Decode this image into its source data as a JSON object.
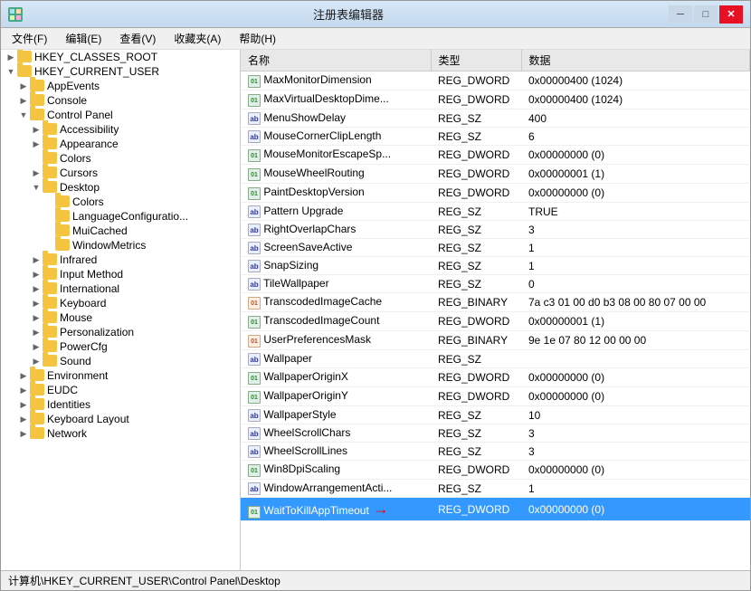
{
  "window": {
    "title": "注册表编辑器",
    "icon": "reg"
  },
  "menu": {
    "items": [
      "文件(F)",
      "编辑(E)",
      "查看(V)",
      "收藏夹(A)",
      "帮助(H)"
    ]
  },
  "tree": {
    "items": [
      {
        "id": "classes_root",
        "label": "HKEY_CLASSES_ROOT",
        "indent": "indent1",
        "toggle": "▶",
        "expanded": false
      },
      {
        "id": "current_user",
        "label": "HKEY_CURRENT_USER",
        "indent": "indent1",
        "toggle": "▼",
        "expanded": true
      },
      {
        "id": "appevents",
        "label": "AppEvents",
        "indent": "indent2",
        "toggle": "▶",
        "expanded": false
      },
      {
        "id": "console",
        "label": "Console",
        "indent": "indent2",
        "toggle": "▶",
        "expanded": false
      },
      {
        "id": "control_panel",
        "label": "Control Panel",
        "indent": "indent2",
        "toggle": "▼",
        "expanded": true
      },
      {
        "id": "accessibility",
        "label": "Accessibility",
        "indent": "indent3",
        "toggle": "▶",
        "expanded": false
      },
      {
        "id": "appearance",
        "label": "Appearance",
        "indent": "indent3",
        "toggle": "▶",
        "expanded": false
      },
      {
        "id": "colors",
        "label": "Colors",
        "indent": "indent3",
        "toggle": "",
        "expanded": false
      },
      {
        "id": "cursors",
        "label": "Cursors",
        "indent": "indent3",
        "toggle": "▶",
        "expanded": false
      },
      {
        "id": "desktop",
        "label": "Desktop",
        "indent": "indent3",
        "toggle": "▼",
        "expanded": true
      },
      {
        "id": "desktop_colors",
        "label": "Colors",
        "indent": "indent4",
        "toggle": "",
        "expanded": false
      },
      {
        "id": "lang_config",
        "label": "LanguageConfiguratio...",
        "indent": "indent4",
        "toggle": "",
        "expanded": false
      },
      {
        "id": "muilcached",
        "label": "MuiCached",
        "indent": "indent4",
        "toggle": "",
        "expanded": false
      },
      {
        "id": "window_metrics",
        "label": "WindowMetrics",
        "indent": "indent4",
        "toggle": "",
        "expanded": false
      },
      {
        "id": "infrared",
        "label": "Infrared",
        "indent": "indent3",
        "toggle": "▶",
        "expanded": false
      },
      {
        "id": "input_method",
        "label": "Input Method",
        "indent": "indent3",
        "toggle": "▶",
        "expanded": false
      },
      {
        "id": "international",
        "label": "International",
        "indent": "indent3",
        "toggle": "▶",
        "expanded": false
      },
      {
        "id": "keyboard",
        "label": "Keyboard",
        "indent": "indent3",
        "toggle": "▶",
        "expanded": false
      },
      {
        "id": "mouse",
        "label": "Mouse",
        "indent": "indent3",
        "toggle": "▶",
        "expanded": false
      },
      {
        "id": "personalization",
        "label": "Personalization",
        "indent": "indent3",
        "toggle": "▶",
        "expanded": false
      },
      {
        "id": "powercfg",
        "label": "PowerCfg",
        "indent": "indent3",
        "toggle": "▶",
        "expanded": false
      },
      {
        "id": "sound",
        "label": "Sound",
        "indent": "indent3",
        "toggle": "▶",
        "expanded": false
      },
      {
        "id": "environment",
        "label": "Environment",
        "indent": "indent2",
        "toggle": "▶",
        "expanded": false
      },
      {
        "id": "eudc",
        "label": "EUDC",
        "indent": "indent2",
        "toggle": "▶",
        "expanded": false
      },
      {
        "id": "identities",
        "label": "Identities",
        "indent": "indent2",
        "toggle": "▶",
        "expanded": false
      },
      {
        "id": "keyboard_layout",
        "label": "Keyboard Layout",
        "indent": "indent2",
        "toggle": "▶",
        "expanded": false
      },
      {
        "id": "network",
        "label": "Network",
        "indent": "indent2",
        "toggle": "▶",
        "expanded": false
      }
    ]
  },
  "table": {
    "headers": [
      "名称",
      "类型",
      "数据"
    ],
    "rows": [
      {
        "name": "MaxMonitorDimension",
        "type": "REG_DWORD",
        "data": "0x00000400 (1024)",
        "icon": "dword"
      },
      {
        "name": "MaxVirtualDesktopDime...",
        "type": "REG_DWORD",
        "data": "0x00000400 (1024)",
        "icon": "dword"
      },
      {
        "name": "MenuShowDelay",
        "type": "REG_SZ",
        "data": "400",
        "icon": "ab"
      },
      {
        "name": "MouseCornerClipLength",
        "type": "REG_SZ",
        "data": "6",
        "icon": "ab"
      },
      {
        "name": "MouseMonitorEscapeSp...",
        "type": "REG_DWORD",
        "data": "0x00000000 (0)",
        "icon": "dword"
      },
      {
        "name": "MouseWheelRouting",
        "type": "REG_DWORD",
        "data": "0x00000001 (1)",
        "icon": "dword"
      },
      {
        "name": "PaintDesktopVersion",
        "type": "REG_DWORD",
        "data": "0x00000000 (0)",
        "icon": "dword"
      },
      {
        "name": "Pattern Upgrade",
        "type": "REG_SZ",
        "data": "TRUE",
        "icon": "ab"
      },
      {
        "name": "RightOverlapChars",
        "type": "REG_SZ",
        "data": "3",
        "icon": "ab"
      },
      {
        "name": "ScreenSaveActive",
        "type": "REG_SZ",
        "data": "1",
        "icon": "ab"
      },
      {
        "name": "SnapSizing",
        "type": "REG_SZ",
        "data": "1",
        "icon": "ab"
      },
      {
        "name": "TileWallpaper",
        "type": "REG_SZ",
        "data": "0",
        "icon": "ab"
      },
      {
        "name": "TranscodedImageCache",
        "type": "REG_BINARY",
        "data": "7a c3 01 00 d0 b3 08 00 80 07 00 00",
        "icon": "bin"
      },
      {
        "name": "TranscodedImageCount",
        "type": "REG_DWORD",
        "data": "0x00000001 (1)",
        "icon": "dword"
      },
      {
        "name": "UserPreferencesMask",
        "type": "REG_BINARY",
        "data": "9e 1e 07 80 12 00 00 00",
        "icon": "bin"
      },
      {
        "name": "Wallpaper",
        "type": "REG_SZ",
        "data": "",
        "icon": "ab"
      },
      {
        "name": "WallpaperOriginX",
        "type": "REG_DWORD",
        "data": "0x00000000 (0)",
        "icon": "dword"
      },
      {
        "name": "WallpaperOriginY",
        "type": "REG_DWORD",
        "data": "0x00000000 (0)",
        "icon": "dword"
      },
      {
        "name": "WallpaperStyle",
        "type": "REG_SZ",
        "data": "10",
        "icon": "ab"
      },
      {
        "name": "WheelScrollChars",
        "type": "REG_SZ",
        "data": "3",
        "icon": "ab"
      },
      {
        "name": "WheelScrollLines",
        "type": "REG_SZ",
        "data": "3",
        "icon": "ab"
      },
      {
        "name": "Win8DpiScaling",
        "type": "REG_DWORD",
        "data": "0x00000000 (0)",
        "icon": "dword"
      },
      {
        "name": "WindowArrangementActi...",
        "type": "REG_SZ",
        "data": "1",
        "icon": "ab"
      },
      {
        "name": "WaitToKillAppTimeout",
        "type": "REG_DWORD",
        "data": "0x00000000 (0)",
        "icon": "dword",
        "selected": true
      }
    ]
  },
  "status_bar": {
    "text": "计算机\\HKEY_CURRENT_USER\\Control Panel\\Desktop"
  }
}
